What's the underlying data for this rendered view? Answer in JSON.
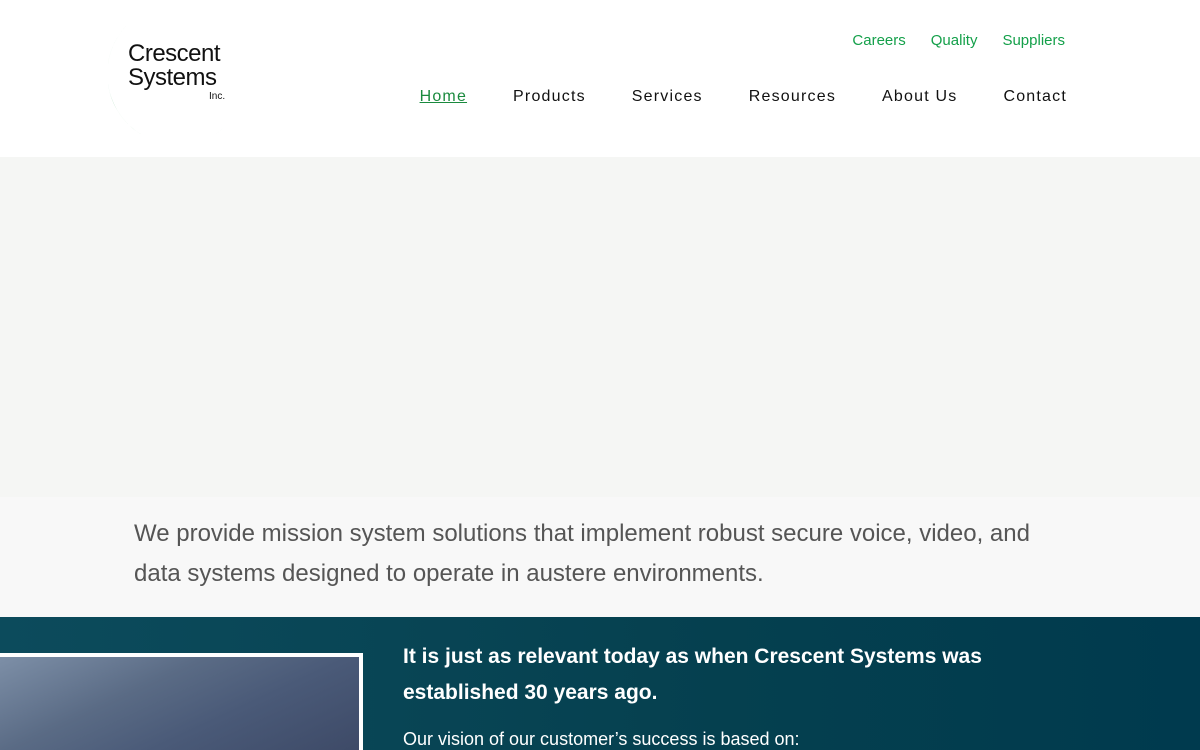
{
  "logo": {
    "line1": "Crescent",
    "line2": "Systems",
    "line3": "Inc."
  },
  "utility_nav": [
    {
      "label": "Careers"
    },
    {
      "label": "Quality"
    },
    {
      "label": "Suppliers"
    }
  ],
  "main_nav": [
    {
      "label": "Home",
      "active": true
    },
    {
      "label": "Products"
    },
    {
      "label": "Services"
    },
    {
      "label": "Resources"
    },
    {
      "label": "About Us"
    },
    {
      "label": "Contact"
    }
  ],
  "intro": {
    "text": "We provide mission system solutions that implement robust secure voice, video, and data systems designed to operate in austere environments."
  },
  "band": {
    "heading": "It is just as relevant today as when Crescent Systems was established 30 years ago.",
    "subheading": "Our vision of our customer’s success is based on:"
  },
  "colors": {
    "brand_green": "#14a04a",
    "band_teal": "#05404f"
  }
}
